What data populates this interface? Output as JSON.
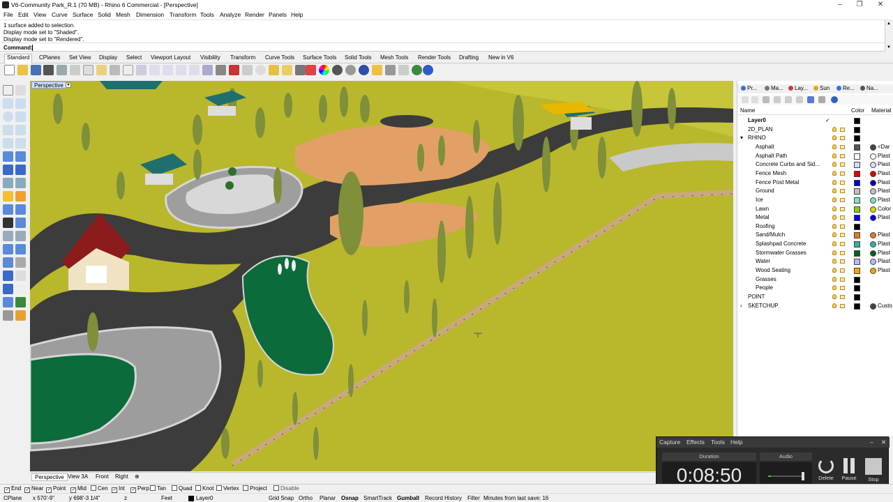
{
  "window": {
    "title": "V6-Community Park_R.1 (70 MB) - Rhino 6 Commercial - [Perspective]",
    "minimize": "–",
    "restore": "❐",
    "close": "✕"
  },
  "menu": [
    "File",
    "Edit",
    "View",
    "Curve",
    "Surface",
    "Solid",
    "Mesh",
    "Dimension",
    "Transform",
    "Tools",
    "Analyze",
    "Render",
    "Panels",
    "Help"
  ],
  "history": [
    "1 surface added to selection.",
    "Display mode set to \"Shaded\".",
    "Display mode set to \"Rendered\"."
  ],
  "command": {
    "label": "Command:",
    "value": ""
  },
  "toolbar_tabs": [
    "Standard",
    "CPlanes",
    "Set View",
    "Display",
    "Select",
    "Viewport Layout",
    "Visibility",
    "Transform",
    "Curve Tools",
    "Surface Tools",
    "Solid Tools",
    "Mesh Tools",
    "Render Tools",
    "Drafting",
    "New in V6"
  ],
  "viewport": {
    "name": "Perspective"
  },
  "view_tabs": [
    "Perspective",
    "View 3A",
    "Front",
    "Right"
  ],
  "view_tab_add": "⊕",
  "panel_tabs": [
    "Pr...",
    "Ma...",
    "Lay...",
    "Sun",
    "Re...",
    "Na..."
  ],
  "panel_tab_colors": [
    "#3a6fd8",
    "#777777",
    "#d23b3b",
    "#e8a324",
    "#3a6fd8",
    "#555555"
  ],
  "layer_headers": {
    "name": "Name",
    "color": "Color",
    "material": "Material"
  },
  "layers": [
    {
      "name": "Layer0",
      "indent": 0,
      "color": "#000000",
      "material": "",
      "mat_color": "",
      "current": true,
      "check": "✓"
    },
    {
      "name": "2D_PLAN",
      "indent": 0,
      "color": "#000000",
      "material": "",
      "mat_color": ""
    },
    {
      "name": "RHINO",
      "indent": 0,
      "color": "#000000",
      "material": "",
      "mat_color": "",
      "expander": "▾"
    },
    {
      "name": "Asphalt",
      "indent": 1,
      "color": "#555555",
      "material": "<Dar",
      "mat_color": "#444444"
    },
    {
      "name": "Asphalt Path",
      "indent": 1,
      "color": "#ffffff",
      "material": "Plast",
      "mat_color": "#ffffff"
    },
    {
      "name": "Concrete Curbs and Sid...",
      "indent": 1,
      "color": "#d8d8ff",
      "material": "Plast",
      "mat_color": "#d8d8ff"
    },
    {
      "name": "Fence Mesh",
      "indent": 1,
      "color": "#e00000",
      "material": "Plast",
      "mat_color": "#e00000"
    },
    {
      "name": "Fence Post Metal",
      "indent": 1,
      "color": "#0000cc",
      "material": "Plast",
      "mat_color": "#0000cc"
    },
    {
      "name": "Ground",
      "indent": 1,
      "color": "#c0c0c0",
      "material": "Plast",
      "mat_color": "#c0c0c0"
    },
    {
      "name": "Ice",
      "indent": 1,
      "color": "#7fe0c0",
      "material": "Plast",
      "mat_color": "#7fe0c0"
    },
    {
      "name": "Lawn",
      "indent": 1,
      "color": "#88cc22",
      "material": "Color",
      "mat_color": "#d6d600"
    },
    {
      "name": "Metal",
      "indent": 1,
      "color": "#0000ee",
      "material": "Plast",
      "mat_color": "#0000ee"
    },
    {
      "name": "Roofing",
      "indent": 1,
      "color": "#000000",
      "material": "",
      "mat_color": ""
    },
    {
      "name": "Sand/Mulch",
      "indent": 1,
      "color": "#e87818",
      "material": "Plast",
      "mat_color": "#e87818"
    },
    {
      "name": "Splashpad Concrete",
      "indent": 1,
      "color": "#30b0a0",
      "material": "Plast",
      "mat_color": "#30b0a0"
    },
    {
      "name": "Stormwater Grasses",
      "indent": 1,
      "color": "#006020",
      "material": "Plast",
      "mat_color": "#006020"
    },
    {
      "name": "Water",
      "indent": 1,
      "color": "#b8b8ff",
      "material": "Plast",
      "mat_color": "#b8b8ff"
    },
    {
      "name": "Wood Seating",
      "indent": 1,
      "color": "#f0a800",
      "material": "Plast",
      "mat_color": "#f0a800"
    },
    {
      "name": "Grasses",
      "indent": 1,
      "color": "#000000",
      "material": "",
      "mat_color": ""
    },
    {
      "name": "People",
      "indent": 1,
      "color": "#000000",
      "material": "",
      "mat_color": ""
    },
    {
      "name": "POINT",
      "indent": 0,
      "color": "#000000",
      "material": "",
      "mat_color": ""
    },
    {
      "name": "SKETCHUP",
      "indent": 0,
      "color": "#000000",
      "material": "Custo",
      "mat_color": "#444444",
      "expander": "›"
    }
  ],
  "capture": {
    "menu": [
      "Capture",
      "Effects",
      "Tools",
      "Help"
    ],
    "window_minimize": "–",
    "window_close": "✕",
    "duration_label": "Duration",
    "duration": "0:08:50",
    "audio_label": "Audio",
    "audio_level": 0.05,
    "buttons": [
      "Delete",
      "Pause",
      "Stop"
    ]
  },
  "osnaps": [
    {
      "label": "End",
      "checked": true
    },
    {
      "label": "Near",
      "checked": true
    },
    {
      "label": "Point",
      "checked": true
    },
    {
      "label": "Mid",
      "checked": true
    },
    {
      "label": "Cen",
      "checked": false
    },
    {
      "label": "Int",
      "checked": true
    },
    {
      "label": "Perp",
      "checked": true
    },
    {
      "label": "Tan",
      "checked": false
    },
    {
      "label": "Quad",
      "checked": false
    },
    {
      "label": "Knot",
      "checked": false
    },
    {
      "label": "Vertex",
      "checked": false
    },
    {
      "label": "Project",
      "checked": false
    },
    {
      "label": "Disable",
      "checked": false
    }
  ],
  "status": {
    "cplane": "CPlane",
    "x": "x 570'-9\"",
    "y": "y 698'-3 1/4\"",
    "z": "z",
    "units": "Feet",
    "layer": "Layer0",
    "toggles": [
      "Grid Snap",
      "Ortho",
      "Planar",
      "Osnap",
      "SmartTrack",
      "Gumball",
      "Record History",
      "Filter"
    ],
    "active_toggles": [
      "Osnap",
      "Gumball"
    ],
    "message": "Minutes from last save: 16"
  },
  "colors": {
    "ground": "#b9b72b",
    "asphalt": "#3c3c3c",
    "sand": "#e2a067",
    "concrete": "#d6d6d6",
    "stormwater": "#0b6b3a"
  }
}
